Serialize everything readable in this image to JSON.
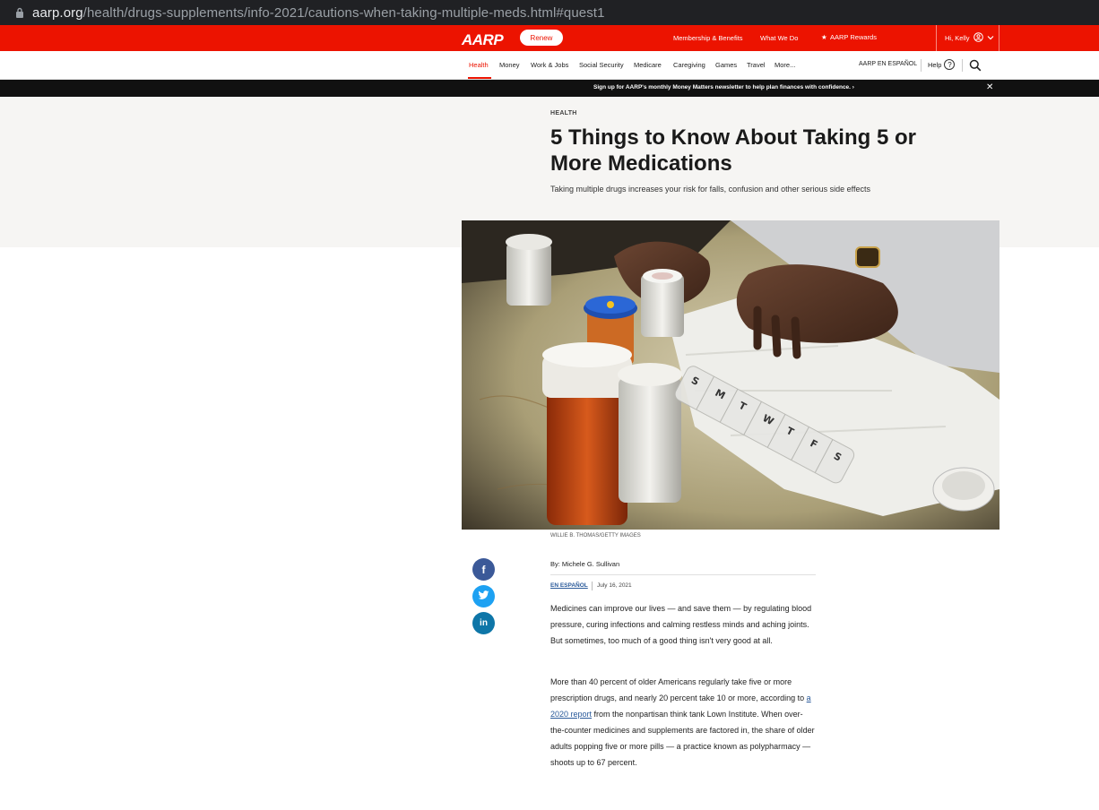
{
  "browser": {
    "url_domain": "aarp.org",
    "url_path": "/health/drugs-supplements/info-2021/cautions-when-taking-multiple-meds.html#quest1"
  },
  "header": {
    "logo": "AARP",
    "renew_label": "Renew",
    "links": [
      "Membership & Benefits",
      "What We Do",
      "AARP Rewards"
    ],
    "user_greeting": "Hi, Kelly"
  },
  "nav": {
    "items": [
      "Health",
      "Money",
      "Work & Jobs",
      "Social Security",
      "Medicare",
      "Caregiving",
      "Games",
      "Travel",
      "More..."
    ],
    "espanol": "AARP EN ESPAÑOL",
    "help": "Help",
    "help_glyph": "?"
  },
  "banner": {
    "text": "Sign up for AARP's monthly Money Matters newsletter to help plan finances with confidence. ›"
  },
  "article": {
    "kicker": "HEALTH",
    "title": "5 Things to Know About Taking 5 or More Medications",
    "subtitle": "Taking multiple drugs increases your risk for falls, confusion and other serious side effects",
    "photo_credit": "WILLIE B. THOMAS/GETTY IMAGES",
    "byline": "By: Michele G. Sullivan",
    "espanol_link": "EN ESPAÑOL",
    "date": "July 16, 2021",
    "p1": "Medicines can improve our lives — and save them — by regulating blood pressure, curing infections and calming restless minds and aching joints. But sometimes, too much of a good thing isn't very good at all.",
    "p2_before": "More than 40 percent of older Americans regularly take five or more prescription drugs, and nearly 20 percent take 10 or more, according to ",
    "p2_link": "a 2020 report",
    "p2_after": " from the nonpartisan think tank Lown Institute. When over-the-counter medicines and supplements are factored in, the share of older adults popping five or more pills — a practice known as polypharmacy — shoots up to 67 percent."
  },
  "share": {
    "facebook": "f",
    "twitter": "t",
    "linkedin": "in"
  },
  "pill_box_letters": [
    "S",
    "M",
    "T",
    "W",
    "T",
    "F",
    "S"
  ],
  "colors": {
    "brand_red": "#ec1300",
    "banner_black": "#111111",
    "hero_bg": "#f6f5f3",
    "link_blue": "#2a5a9a"
  }
}
